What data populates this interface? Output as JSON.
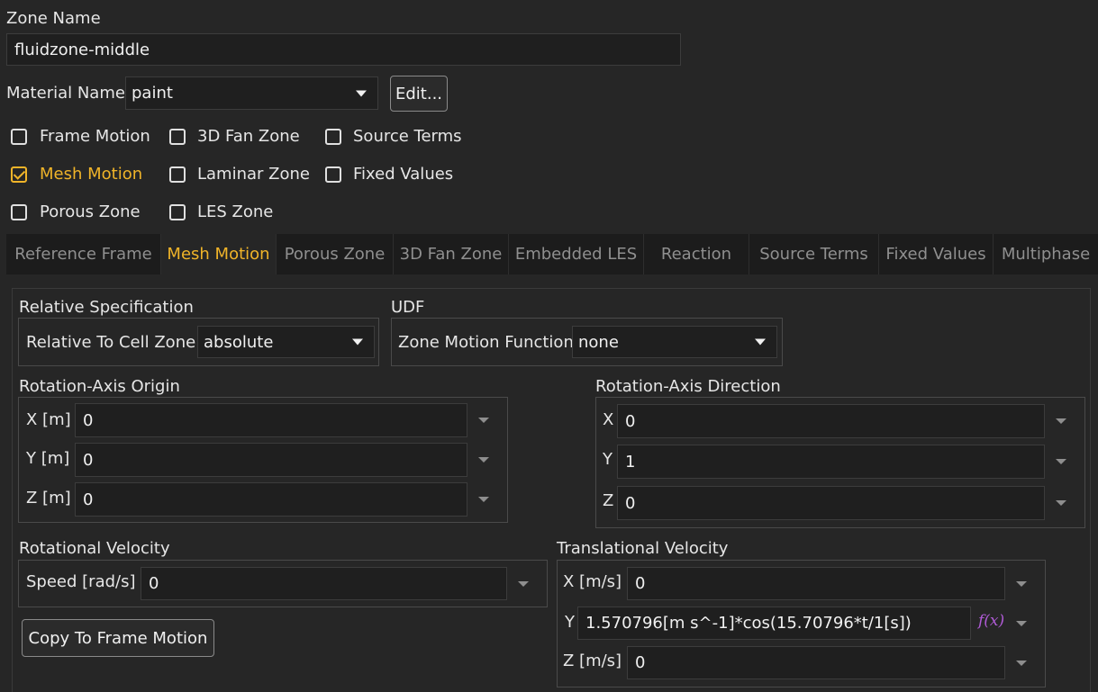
{
  "zone_name": {
    "label": "Zone Name",
    "value": "fluidzone-middle"
  },
  "material": {
    "label": "Material Name",
    "value": "paint",
    "edit_button": "Edit..."
  },
  "checkboxes": [
    {
      "label": "Frame Motion",
      "checked": false
    },
    {
      "label": "3D Fan Zone",
      "checked": false
    },
    {
      "label": "Source Terms",
      "checked": false
    },
    {
      "label": "Mesh Motion",
      "checked": true
    },
    {
      "label": "Laminar Zone",
      "checked": false
    },
    {
      "label": "Fixed Values",
      "checked": false
    },
    {
      "label": "Porous Zone",
      "checked": false
    },
    {
      "label": "LES Zone",
      "checked": false
    }
  ],
  "tabs": [
    {
      "label": "Reference Frame"
    },
    {
      "label": "Mesh Motion",
      "active": true
    },
    {
      "label": "Porous Zone"
    },
    {
      "label": "3D Fan Zone"
    },
    {
      "label": "Embedded LES"
    },
    {
      "label": "Reaction"
    },
    {
      "label": "Source Terms"
    },
    {
      "label": "Fixed Values"
    },
    {
      "label": "Multiphase"
    }
  ],
  "relative_spec": {
    "title": "Relative Specification",
    "label": "Relative To Cell Zone",
    "value": "absolute"
  },
  "udf": {
    "title": "UDF",
    "label": "Zone Motion Function",
    "value": "none"
  },
  "origin": {
    "title": "Rotation-Axis Origin",
    "fields": [
      {
        "label": "X [m]",
        "value": "0"
      },
      {
        "label": "Y [m]",
        "value": "0"
      },
      {
        "label": "Z [m]",
        "value": "0"
      }
    ]
  },
  "direction": {
    "title": "Rotation-Axis Direction",
    "fields": [
      {
        "label": "X",
        "value": "0"
      },
      {
        "label": "Y",
        "value": "1"
      },
      {
        "label": "Z",
        "value": "0"
      }
    ]
  },
  "rot_velocity": {
    "title": "Rotational Velocity",
    "label": "Speed [rad/s]",
    "value": "0"
  },
  "copy_button": "Copy To Frame Motion",
  "trans_velocity": {
    "title": "Translational Velocity",
    "fields": [
      {
        "label": "X [m/s]",
        "value": "0"
      },
      {
        "label": "Y",
        "value": "1.570796[m s^-1]*cos(15.70796*t/1[s])"
      },
      {
        "label": "Z [m/s]",
        "value": "0"
      }
    ],
    "fx_icon": "f(x)"
  },
  "colors": {
    "accent": "#f0b429",
    "fx": "#b05bd6",
    "background": "#262626"
  }
}
